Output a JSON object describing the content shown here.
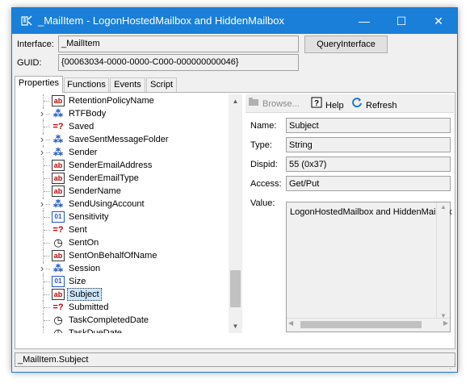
{
  "window": {
    "title": "_MailItem - LogonHostedMailbox and HiddenMailbox",
    "app_icon": "window-icon",
    "controls": {
      "minimize": "—",
      "maximize": "☐",
      "close": "✕"
    }
  },
  "header": {
    "interface_label": "Interface:",
    "interface_value": "_MailItem",
    "query_button": "QueryInterface",
    "guid_label": "GUID:",
    "guid_value": "{00063034-0000-0000-C000-000000000046}"
  },
  "tabs": [
    {
      "label": "Properties",
      "active": true
    },
    {
      "label": "Functions",
      "active": false
    },
    {
      "label": "Events",
      "active": false
    },
    {
      "label": "Script",
      "active": false
    }
  ],
  "tree": {
    "items": [
      {
        "label": "RetentionPolicyName",
        "icon": "string-icon",
        "expandable": false,
        "selected": false
      },
      {
        "label": "RTFBody",
        "icon": "object-icon",
        "expandable": true,
        "selected": false
      },
      {
        "label": "Saved",
        "icon": "boolean-icon",
        "expandable": false,
        "selected": false
      },
      {
        "label": "SaveSentMessageFolder",
        "icon": "object-icon",
        "expandable": true,
        "selected": false
      },
      {
        "label": "Sender",
        "icon": "object-icon",
        "expandable": true,
        "selected": false
      },
      {
        "label": "SenderEmailAddress",
        "icon": "string-icon",
        "expandable": false,
        "selected": false
      },
      {
        "label": "SenderEmailType",
        "icon": "string-icon",
        "expandable": false,
        "selected": false
      },
      {
        "label": "SenderName",
        "icon": "string-icon",
        "expandable": false,
        "selected": false
      },
      {
        "label": "SendUsingAccount",
        "icon": "object-icon",
        "expandable": true,
        "selected": false
      },
      {
        "label": "Sensitivity",
        "icon": "enum-icon",
        "expandable": false,
        "selected": false
      },
      {
        "label": "Sent",
        "icon": "boolean-icon",
        "expandable": false,
        "selected": false
      },
      {
        "label": "SentOn",
        "icon": "datetime-icon",
        "expandable": false,
        "selected": false
      },
      {
        "label": "SentOnBehalfOfName",
        "icon": "string-icon",
        "expandable": false,
        "selected": false
      },
      {
        "label": "Session",
        "icon": "object-icon",
        "expandable": true,
        "selected": false
      },
      {
        "label": "Size",
        "icon": "enum-icon",
        "expandable": false,
        "selected": false
      },
      {
        "label": "Subject",
        "icon": "string-icon",
        "expandable": false,
        "selected": true
      },
      {
        "label": "Submitted",
        "icon": "boolean-icon",
        "expandable": false,
        "selected": false
      },
      {
        "label": "TaskCompletedDate",
        "icon": "datetime-icon",
        "expandable": false,
        "selected": false
      },
      {
        "label": "TaskDueDate",
        "icon": "datetime-icon",
        "expandable": false,
        "selected": false
      }
    ]
  },
  "toolbar": {
    "browse_label": "Browse...",
    "help_label": "Help",
    "refresh_label": "Refresh"
  },
  "details": {
    "name_label": "Name:",
    "name_value": "Subject",
    "type_label": "Type:",
    "type_value": "String",
    "dispid_label": "Dispid:",
    "dispid_value": "55  (0x37)",
    "access_label": "Access:",
    "access_value": "Get/Put",
    "value_label": "Value:",
    "value_text": "LogonHostedMailbox and HiddenMailbox"
  },
  "status": {
    "text": "_MailItem.Subject"
  },
  "colors": {
    "titlebar": "#1a7fd8",
    "selection": "#cce8ff"
  }
}
